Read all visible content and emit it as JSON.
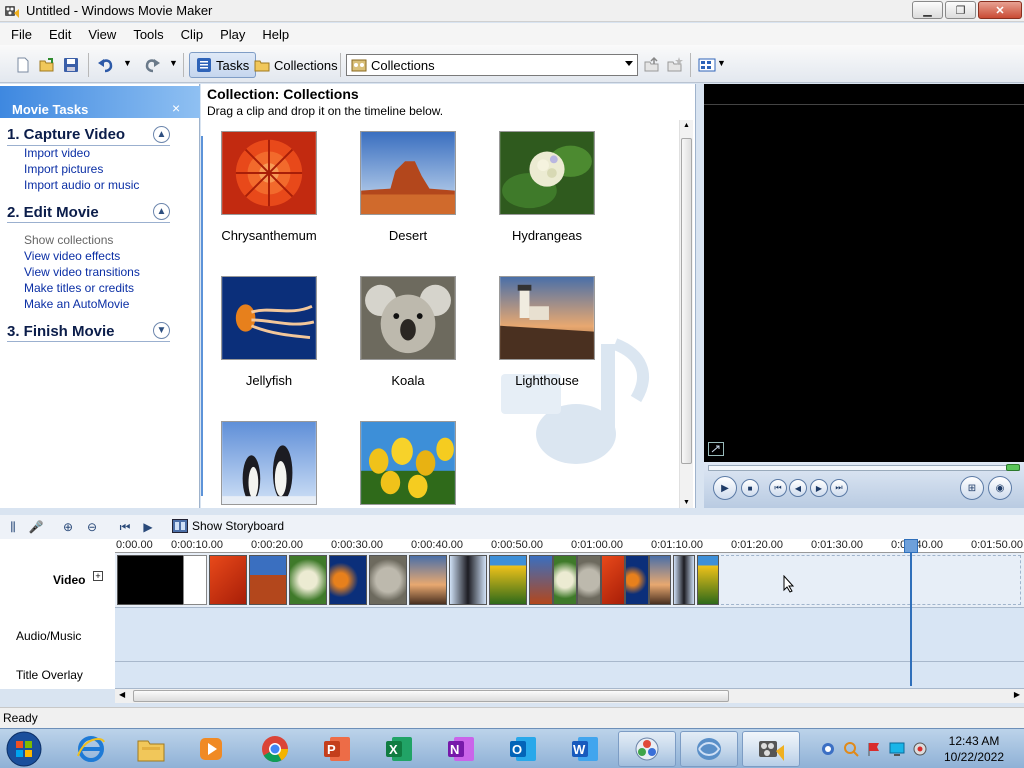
{
  "window": {
    "title": "Untitled - Windows Movie Maker"
  },
  "menu": [
    "File",
    "Edit",
    "View",
    "Tools",
    "Clip",
    "Play",
    "Help"
  ],
  "toolbar": {
    "tasks_label": "Tasks",
    "collections_label": "Collections",
    "dropdown_value": "Collections"
  },
  "tasks_pane": {
    "header": "Movie Tasks",
    "sections": [
      {
        "title": "1. Capture Video",
        "links": [
          "Import video",
          "Import pictures",
          "Import audio or music"
        ]
      },
      {
        "title": "2. Edit Movie",
        "links": [
          "Show collections",
          "View video effects",
          "View video transitions",
          "Make titles or credits",
          "Make an AutoMovie"
        ]
      },
      {
        "title": "3. Finish Movie",
        "links": []
      }
    ]
  },
  "collection": {
    "title": "Collection: Collections",
    "subtitle": "Drag a clip and drop it on the timeline below.",
    "items": [
      {
        "label": "Chrysanthemum",
        "icon": "chrysanthemum-thumbnail"
      },
      {
        "label": "Desert",
        "icon": "desert-thumbnail"
      },
      {
        "label": "Hydrangeas",
        "icon": "hydrangeas-thumbnail"
      },
      {
        "label": "Jellyfish",
        "icon": "jellyfish-thumbnail"
      },
      {
        "label": "Koala",
        "icon": "koala-thumbnail"
      },
      {
        "label": "Lighthouse",
        "icon": "lighthouse-thumbnail"
      },
      {
        "label": "",
        "icon": "penguins-thumbnail"
      },
      {
        "label": "",
        "icon": "tulips-thumbnail"
      }
    ]
  },
  "timeline": {
    "storyboard_label": "Show Storyboard",
    "ticks": [
      "0:00.00",
      "0:00:10.00",
      "0:00:20.00",
      "0:00:30.00",
      "0:00:40.00",
      "0:00:50.00",
      "0:01:00.00",
      "0:01:10.00",
      "0:01:20.00",
      "0:01:30.00",
      "0:01:40.00",
      "0:01:50.00"
    ],
    "tracks": [
      "Video",
      "Audio/Music",
      "Title Overlay"
    ]
  },
  "status": {
    "text": "Ready"
  },
  "taskbar": {
    "time": "12:43 AM",
    "date": "10/22/2022"
  }
}
